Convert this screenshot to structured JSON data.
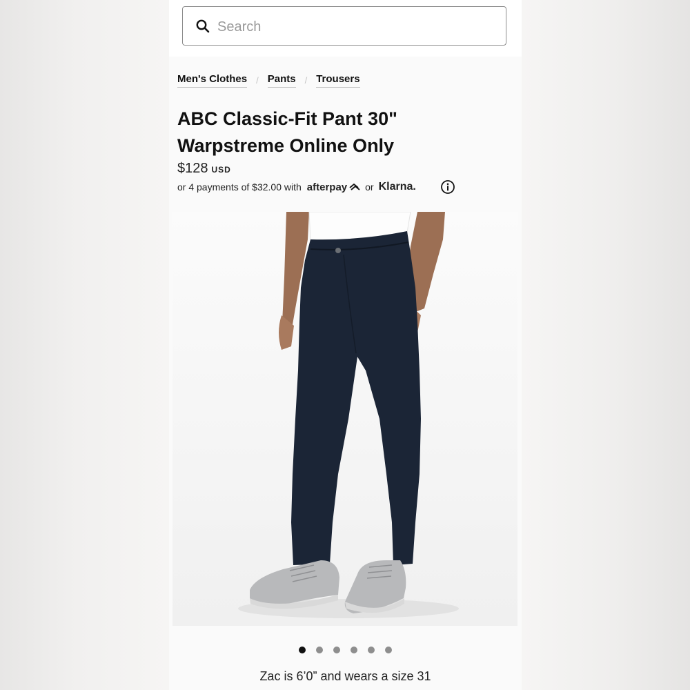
{
  "search": {
    "placeholder": "Search",
    "icon": "search-icon"
  },
  "breadcrumb": [
    {
      "label": "Men's Clothes"
    },
    {
      "label": "Pants"
    },
    {
      "label": "Trousers"
    }
  ],
  "product": {
    "title": "ABC Classic-Fit Pant 30\" Warpstreme Online Only",
    "price": "$128",
    "currency": "USD",
    "installments_prefix": "or 4 payments of $32.00 with",
    "afterpay_label": "afterpay",
    "or_label": "or",
    "klarna_label": "Klarna.",
    "info_icon": "info-icon",
    "pant_color": "#1b2536"
  },
  "gallery": {
    "image_count": 6,
    "active_index": 0,
    "caption": "Zac is 6’0” and wears a size 31"
  }
}
